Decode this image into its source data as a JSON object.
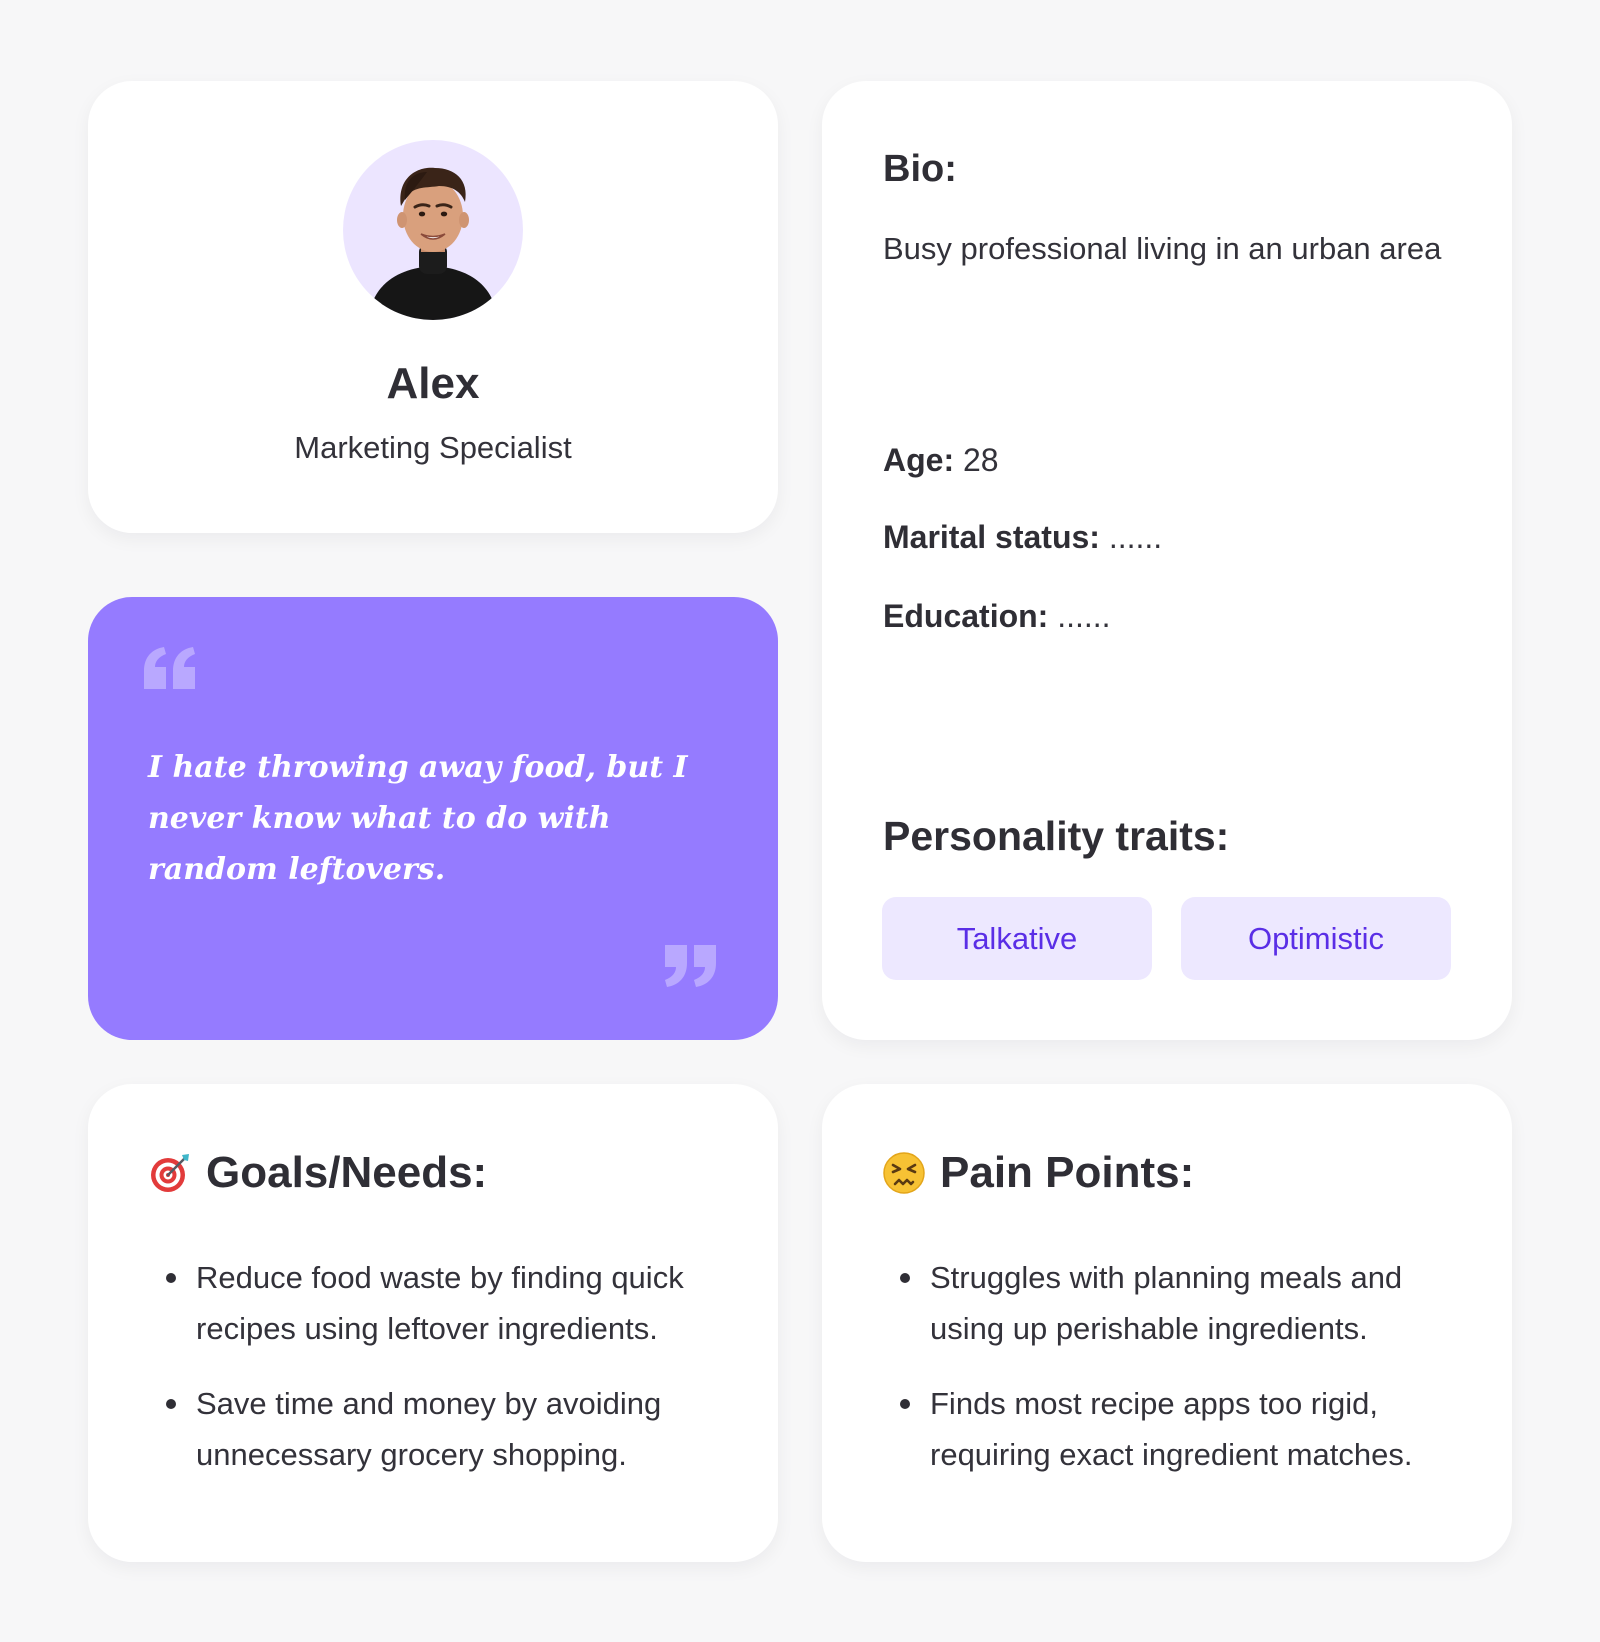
{
  "profile": {
    "name": "Alex",
    "role": "Marketing Specialist",
    "avatar_icon": "person-avatar"
  },
  "quote": {
    "text": "I hate throwing away food, but I never know what to do with random leftovers.",
    "open_icon": "open-quote-icon",
    "close_icon": "close-quote-icon",
    "background_color": "#957bff"
  },
  "bio": {
    "heading": "Bio:",
    "text": "Busy professional living in an urban area",
    "age_label": "Age:",
    "age_value": "28",
    "marital_label": "Marital status:",
    "marital_value": "......",
    "education_label": "Education:",
    "education_value": "......",
    "traits_heading": "Personality traits:",
    "traits": [
      "Talkative",
      "Optimistic"
    ],
    "trait_color": "#5a2ee6",
    "trait_bg": "#ede8ff"
  },
  "goals": {
    "icon": "target-dart-icon",
    "heading": "Goals/Needs:",
    "items": [
      "Reduce food waste by finding quick recipes using leftover ingredients.",
      "Save time and money by avoiding unnecessary grocery shopping."
    ]
  },
  "pains": {
    "icon": "confounded-face-icon",
    "heading": "Pain Points:",
    "items": [
      "Struggles with planning meals and using up perishable ingredients.",
      "Finds most recipe apps too rigid, requiring exact ingredient matches."
    ]
  }
}
